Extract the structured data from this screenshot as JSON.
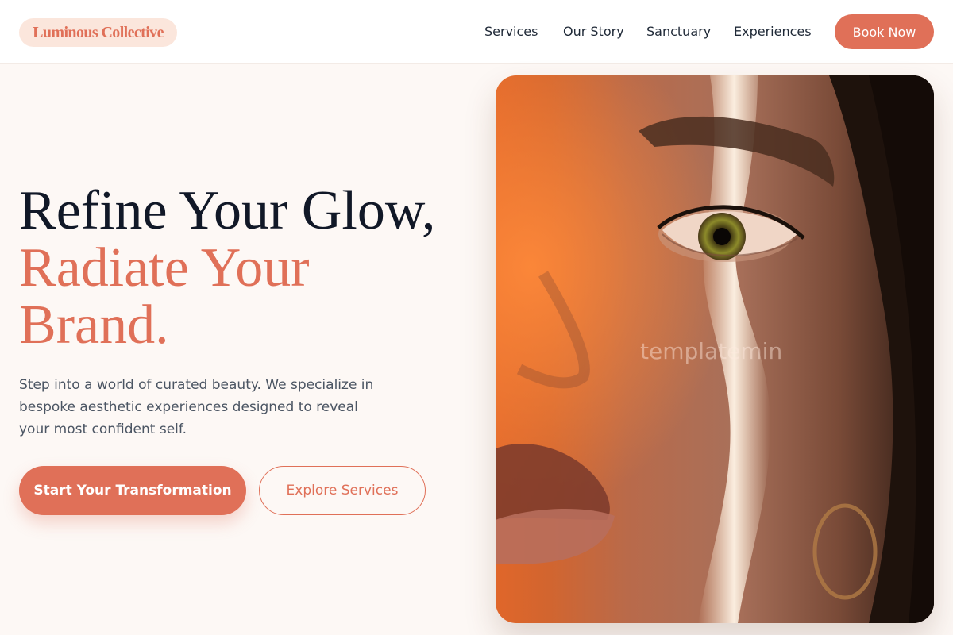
{
  "brand": {
    "logo_text": "Luminous Collective",
    "accent_color": "#e07058",
    "dark_text_color": "#111827"
  },
  "nav": {
    "links": [
      "Services",
      "Our Story",
      "Sanctuary",
      "Experiences"
    ],
    "book_label": "Book Now"
  },
  "hero": {
    "headline_line1": "Refine Your Glow,",
    "headline_line2": "Radiate Your",
    "headline_line3": "Brand.",
    "subtitle": "Step into a world of curated beauty. We specialize in bespoke aesthetic experiences designed to reveal your most confident self.",
    "primary_cta": "Start Your Transformation",
    "secondary_cta": "Explore Services"
  },
  "image": {
    "subject": "close-up-face-photo",
    "watermark": "templatemin"
  }
}
